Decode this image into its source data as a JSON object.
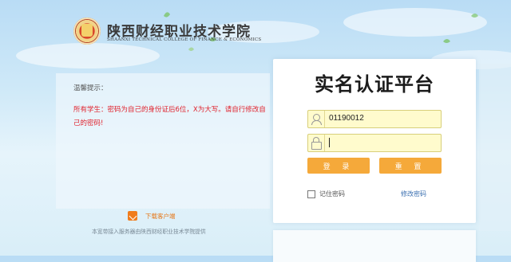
{
  "header": {
    "college_name_cn": "陕西财经职业技术学院",
    "college_name_en": "SHAANXI TECHNICAL COLLEGE OF FINANCE & ECONOMICS"
  },
  "notice": {
    "title": "温馨提示：",
    "body": "所有学生：密码为自己的身份证后6位，X为大写。请自行修改自己的密码!"
  },
  "login": {
    "title": "实名认证平台",
    "username_value": "01190012",
    "password_value": "",
    "login_button": "登 录",
    "reset_button": "重 置",
    "remember_label": "记住密码",
    "change_password_link": "修改密码"
  },
  "download": {
    "label": "下载客户端"
  },
  "footer": {
    "text": "本宽带接入服务器由陕西财经职业技术学院提供"
  },
  "icons": {
    "logo": "college-emblem",
    "user": "user-icon",
    "password": "lock-icon",
    "download": "download-icon"
  },
  "colors": {
    "accent_orange": "#f5a93a",
    "notice_red": "#e0232e",
    "input_yellow": "#fffbcd",
    "link_blue": "#3a6fb0"
  }
}
